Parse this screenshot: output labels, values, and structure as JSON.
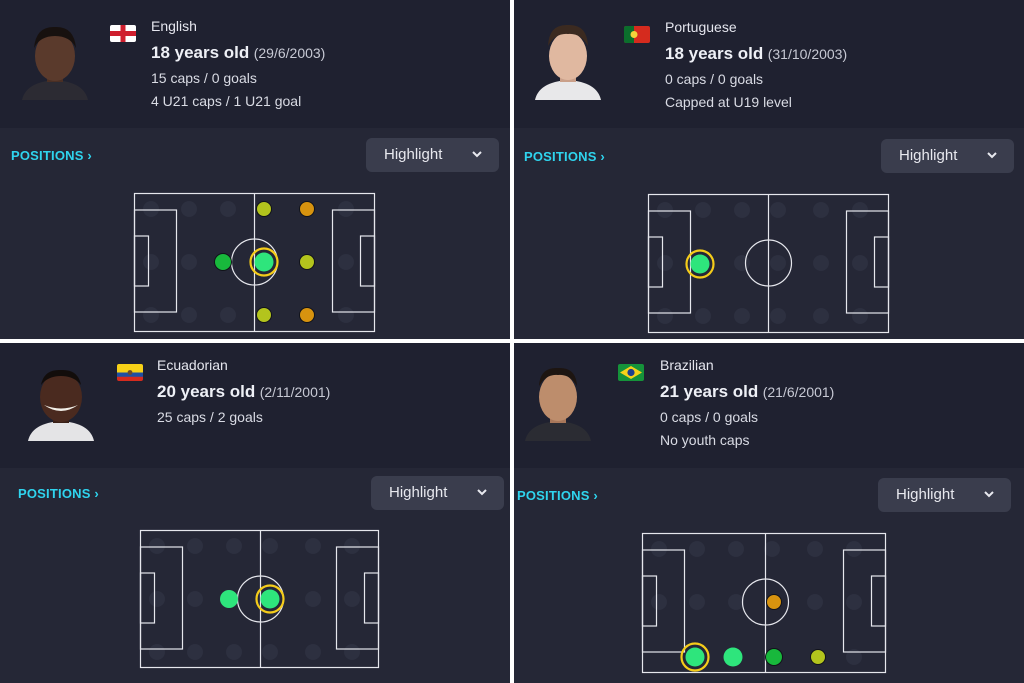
{
  "positions_label": "POSITIONS",
  "highlight_label": "Highlight",
  "colors": {
    "accent": "#2fd4ee",
    "natural": "#2ee57c",
    "accomplished": "#18b83c",
    "competent": "#b3c41d",
    "unconvincing": "#d7930f",
    "selected_ring": "#f5cc1a"
  },
  "players": [
    {
      "nationality": "English",
      "flag": "england-flag",
      "age": "18 years old",
      "dob": "(29/6/2003)",
      "caps": "15 caps / 0 goals",
      "youth": "4 U21 caps / 1 U21 goal"
    },
    {
      "nationality": "Portuguese",
      "flag": "portugal-flag",
      "age": "18 years old",
      "dob": "(31/10/2003)",
      "caps": "0 caps / 0 goals",
      "youth": "Capped at U19 level"
    },
    {
      "nationality": "Ecuadorian",
      "flag": "ecuador-flag",
      "age": "20 years old",
      "dob": "(2/11/2001)",
      "caps": "25 caps / 2 goals",
      "youth": ""
    },
    {
      "nationality": "Brazilian",
      "flag": "brazil-flag",
      "age": "21 years old",
      "dob": "(21/6/2001)",
      "caps": "0 caps / 0 goals",
      "youth": "No youth caps"
    }
  ]
}
